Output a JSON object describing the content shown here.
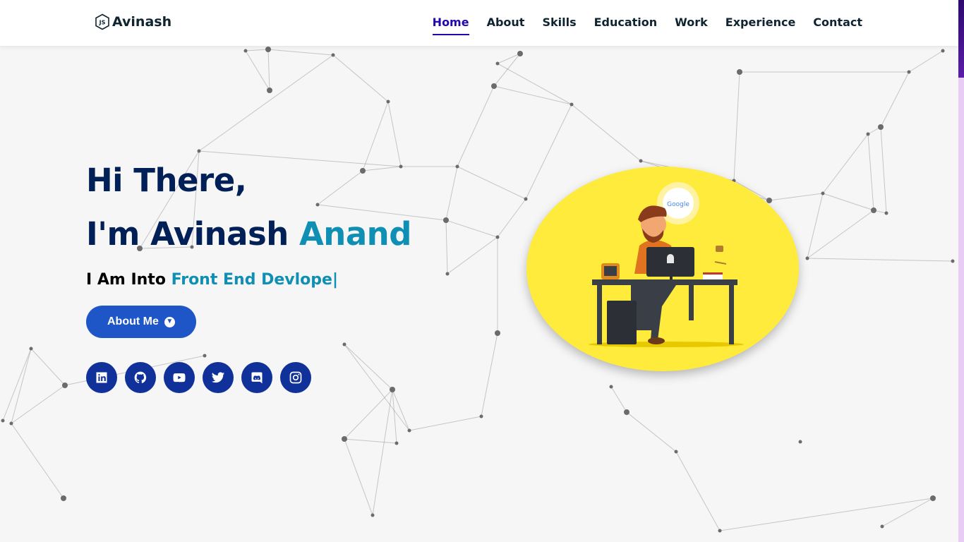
{
  "header": {
    "logo_icon": "node-js-icon",
    "logo_text": "Avinash",
    "nav": [
      {
        "label": "Home",
        "active": true
      },
      {
        "label": "About"
      },
      {
        "label": "Skills"
      },
      {
        "label": "Education"
      },
      {
        "label": "Work"
      },
      {
        "label": "Experience"
      },
      {
        "label": "Contact"
      }
    ]
  },
  "hero": {
    "greeting": "Hi There,",
    "intro": "I'm Avinash ",
    "name_accent": "Anand",
    "typed_prefix": "I Am Into ",
    "typed_text": "Front End Devlope",
    "cursor": "|",
    "about_button": "About Me",
    "about_button_icon": "arrow-down-circle-icon",
    "socials": [
      {
        "name": "linkedin-icon"
      },
      {
        "name": "github-icon"
      },
      {
        "name": "youtube-icon"
      },
      {
        "name": "twitter-icon"
      },
      {
        "name": "discord-icon"
      },
      {
        "name": "instagram-icon"
      }
    ]
  },
  "illustration": {
    "bubble_text": "Google"
  },
  "colors": {
    "heading": "#002057",
    "accent": "#0f8fb3",
    "button": "#1e56c7",
    "social_bg": "#10309a",
    "nav_active": "#2506ad",
    "hero_circle": "#ffeb3b"
  }
}
